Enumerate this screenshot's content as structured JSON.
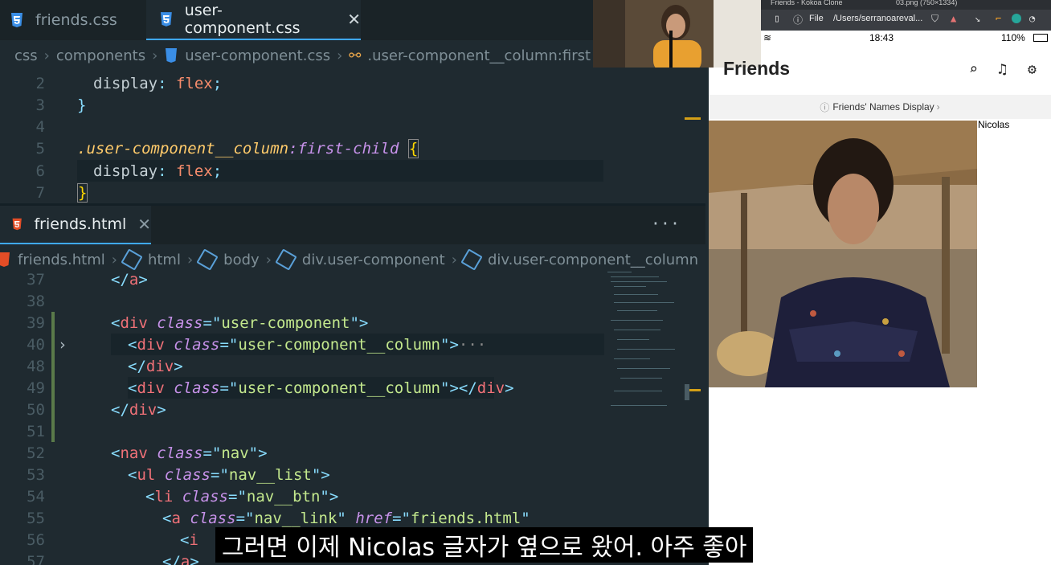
{
  "editor": {
    "top_tabs": [
      {
        "label": "friends.css",
        "active": false
      },
      {
        "label": "user-component.css",
        "active": true
      }
    ],
    "css_breadcrumb": [
      "css",
      "components",
      "user-component.css",
      ".user-component__column:first"
    ],
    "css_lines": [
      {
        "n": "2",
        "text": "display: flex;"
      },
      {
        "n": "3",
        "text": "}"
      },
      {
        "n": "4",
        "text": ""
      },
      {
        "n": "5",
        "selector": ".user-component__column",
        "pseudo": ":first-child",
        "brace": "{"
      },
      {
        "n": "6",
        "text": "display: flex;"
      },
      {
        "n": "7",
        "text": "}"
      }
    ],
    "html_tab": "friends.html",
    "html_breadcrumb": [
      "friends.html",
      "html",
      "body",
      "div.user-component",
      "div.user-component__column"
    ],
    "more_label": "···",
    "html_lines": [
      "37",
      "38",
      "39",
      "40",
      "48",
      "49",
      "50",
      "51",
      "52",
      "53",
      "54",
      "55",
      "56",
      "57"
    ]
  },
  "browser": {
    "tabs": [
      "Friends - Kokoa Clone",
      "03.png (750×1334)"
    ],
    "file_label": "File",
    "url": "/Users/serranoareval...",
    "time": "18:43",
    "battery": "110%",
    "app_title": "Friends",
    "banner_text": "Friends' Names Display",
    "name": "Nicolas"
  },
  "subtitle": "그러면 이제 Nicolas 글자가 옆으로 왔어. 아주 좋아",
  "colors": {
    "accent": "#3fa9ff",
    "editor_bg": "#1f2a30"
  }
}
